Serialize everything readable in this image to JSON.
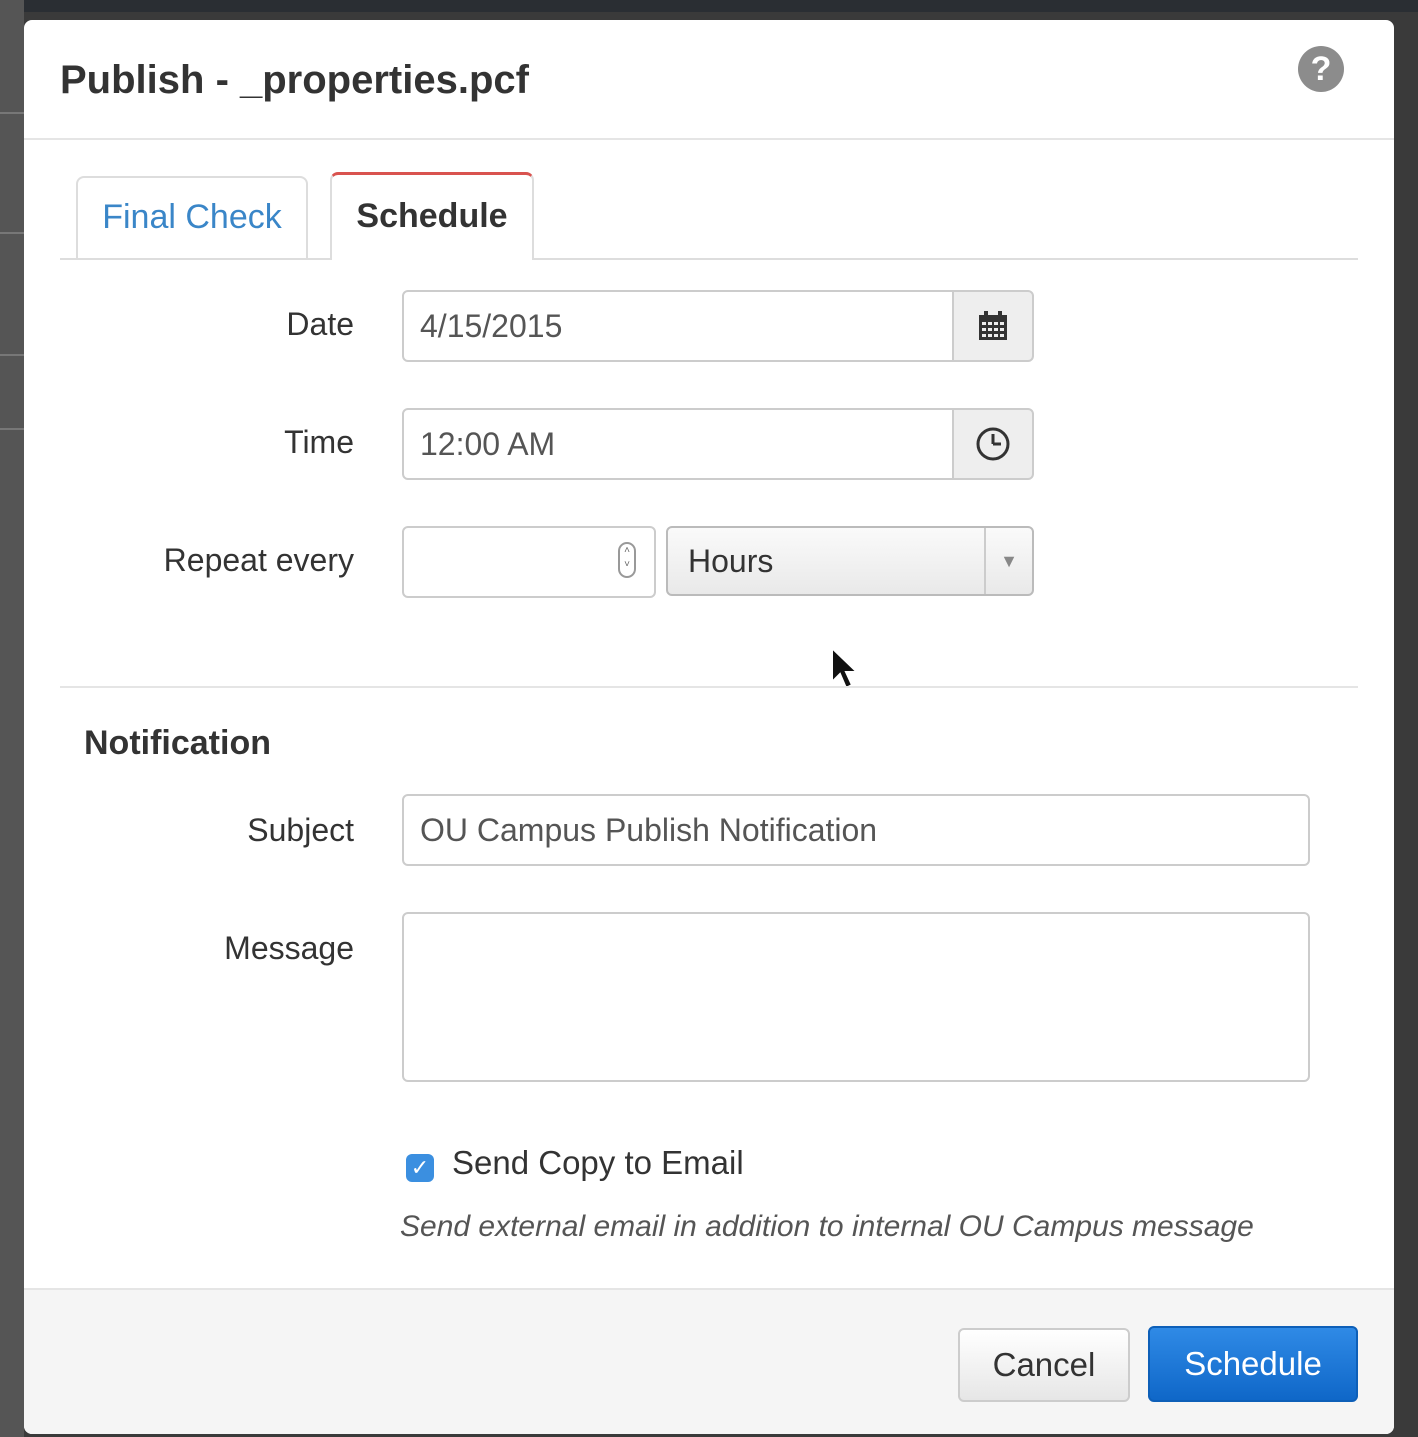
{
  "dialog": {
    "title": "Publish - _properties.pcf",
    "help_icon": "?"
  },
  "tabs": [
    {
      "label": "Final Check",
      "active": false
    },
    {
      "label": "Schedule",
      "active": true
    }
  ],
  "schedule": {
    "date_label": "Date",
    "date_value": "4/15/2015",
    "date_icon": "calendar-icon",
    "time_label": "Time",
    "time_value": "12:00 AM",
    "time_icon": "clock-icon",
    "repeat_label": "Repeat every",
    "repeat_value": "",
    "repeat_unit": "Hours"
  },
  "notification": {
    "heading": "Notification",
    "subject_label": "Subject",
    "subject_value": "OU Campus Publish Notification",
    "message_label": "Message",
    "message_value": "",
    "send_copy_checked": true,
    "send_copy_label": "Send Copy to Email",
    "send_copy_help": "Send external email in addition to internal OU Campus message"
  },
  "footer": {
    "cancel_label": "Cancel",
    "schedule_label": "Schedule"
  },
  "colors": {
    "primary": "#0f67c8",
    "tab_active_accent": "#d9534f",
    "link": "#3a86c8",
    "checkbox": "#3b8fe0"
  }
}
